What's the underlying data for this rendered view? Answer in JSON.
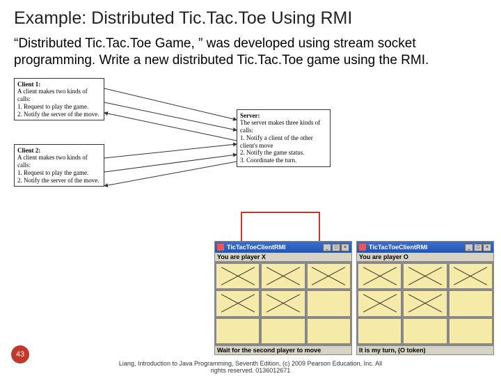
{
  "title": "Example: Distributed Tic.Tac.Toe Using RMI",
  "body": "“Distributed Tic.Tac.Toe Game, ” was developed using stream socket programming. Write a new distributed Tic.Tac.Toe game using the RMI.",
  "diagram": {
    "client1": {
      "head": "Client 1:",
      "l1": "A client makes two kinds of calls:",
      "l2": "1. Request to play the game.",
      "l3": "2. Notify the server of the move."
    },
    "client2": {
      "head": "Client 2:",
      "l1": "A client makes two kinds of calls:",
      "l2": "1. Request to play the game.",
      "l3": "2. Notify the server of the move."
    },
    "server": {
      "head": "Server:",
      "l1": "The server makes three kinds of calls:",
      "l2": "1. Notify a client of the other client's move",
      "l3": "2. Notify the game status.",
      "l4": "3. Coordinate the turn."
    }
  },
  "apps": [
    {
      "title": "TicTacToeClientRMI",
      "status": "You are player X",
      "footer": "Wait for the second player to move",
      "marks": [
        "X",
        "X",
        "X",
        "X",
        "X",
        "",
        "",
        "",
        ""
      ],
      "wbtn": {
        "min": "_",
        "max": "□",
        "close": "×"
      }
    },
    {
      "title": "TicTacToeClientRMI",
      "status": "You are player O",
      "footer": "It is my turn, (O token)",
      "marks": [
        "X",
        "X",
        "X",
        "X",
        "X",
        "",
        "",
        "",
        ""
      ],
      "wbtn": {
        "min": "_",
        "max": "□",
        "close": "×"
      }
    }
  ],
  "pagenum": "43",
  "credit_l1": "Liang, Introduction to Java Programming, Seventh Edition, (c) 2009 Pearson Education, Inc. All",
  "credit_l2": "rights reserved. 0136012671"
}
